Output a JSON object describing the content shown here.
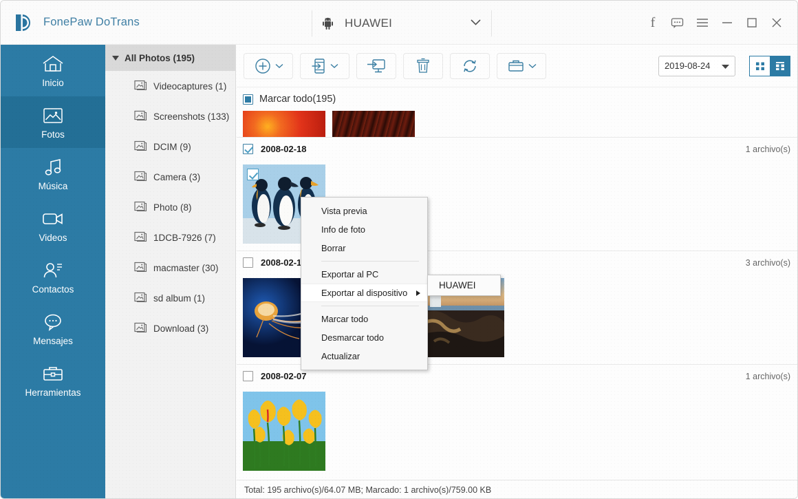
{
  "titlebar": {
    "app_name": "FonePaw DoTrans",
    "logo_glyph": "D",
    "device_name": "HUAWEI",
    "device_icon": "android-icon",
    "device_caret_icon": "chevron-down-icon",
    "controls": [
      {
        "name": "facebook-icon",
        "glyph": "f"
      },
      {
        "name": "feedback-icon",
        "glyph": "…"
      },
      {
        "name": "menu-icon",
        "glyph": "☰"
      },
      {
        "name": "minimize-icon",
        "glyph": "—"
      },
      {
        "name": "maximize-icon",
        "glyph": "□"
      },
      {
        "name": "close-icon",
        "glyph": "✕"
      }
    ]
  },
  "sidebar": {
    "items": [
      {
        "label": "Inicio",
        "icon": "home-icon",
        "active": false
      },
      {
        "label": "Fotos",
        "icon": "photo-icon",
        "active": true
      },
      {
        "label": "Música",
        "icon": "music-icon",
        "active": false
      },
      {
        "label": "Videos",
        "icon": "video-icon",
        "active": false
      },
      {
        "label": "Contactos",
        "icon": "contacts-icon",
        "active": false
      },
      {
        "label": "Mensajes",
        "icon": "message-icon",
        "active": false
      },
      {
        "label": "Herramientas",
        "icon": "toolbox-icon",
        "active": false
      }
    ]
  },
  "tree": {
    "header": "All Photos (195)",
    "header_caret_icon": "triangle-down-icon",
    "items": [
      {
        "label": "Videocaptures (1)",
        "icon": "album-icon"
      },
      {
        "label": "Screenshots (133)",
        "icon": "album-icon"
      },
      {
        "label": "DCIM (9)",
        "icon": "album-icon"
      },
      {
        "label": "Camera (3)",
        "icon": "album-icon"
      },
      {
        "label": "Photo (8)",
        "icon": "album-icon"
      },
      {
        "label": "1DCB-7926 (7)",
        "icon": "album-icon"
      },
      {
        "label": "macmaster (30)",
        "icon": "album-icon"
      },
      {
        "label": "sd album (1)",
        "icon": "album-icon"
      },
      {
        "label": "Download (3)",
        "icon": "album-icon"
      }
    ]
  },
  "toolbar": {
    "buttons": [
      {
        "name": "add-button",
        "icon": "plus-circle-icon",
        "has_caret": true
      },
      {
        "name": "export-to-device-button",
        "icon": "phone-export-icon",
        "has_caret": true
      },
      {
        "name": "export-to-pc-button",
        "icon": "monitor-export-icon",
        "has_caret": false
      },
      {
        "name": "delete-button",
        "icon": "trash-icon",
        "has_caret": false
      },
      {
        "name": "refresh-button",
        "icon": "refresh-icon",
        "has_caret": false
      },
      {
        "name": "album-button",
        "icon": "briefcase-icon",
        "has_caret": true
      }
    ],
    "date_filter_value": "2019-08-24",
    "date_filter_caret_icon": "caret-down-icon",
    "view_list_icon": "grid-small-icon",
    "view_grid_icon": "grid-large-icon",
    "accent_color": "#2c7ba5"
  },
  "content": {
    "select_all_label": "Marcar todo(195)",
    "groups": [
      {
        "date": "2008-02-18",
        "count_label": "1 archivo(s)",
        "checked": true,
        "photos": [
          {
            "name": "photo-penguins",
            "selected": true,
            "colors": [
              "#b7d6ec",
              "#17406b",
              "#f2f6fa"
            ]
          }
        ]
      },
      {
        "date": "2008-02-1",
        "count_label": "3 archivo(s)",
        "checked": false,
        "photos": [
          {
            "name": "photo-jellyfish",
            "selected": false,
            "colors": [
              "#0d2f6b",
              "#1452a8",
              "#e8a33c"
            ]
          },
          {
            "name": "photo-desert",
            "selected": false,
            "colors": [
              "#5c4030",
              "#c58a4e",
              "#e9cfa5"
            ]
          },
          {
            "name": "photo-lighthouse",
            "selected": false,
            "colors": [
              "#2a1f1a",
              "#8d6036",
              "#d9c2a0"
            ]
          }
        ]
      },
      {
        "date": "2008-02-07",
        "count_label": "1 archivo(s)",
        "checked": false,
        "photos": [
          {
            "name": "photo-tulips",
            "selected": false,
            "colors": [
              "#7fc4ea",
              "#f5c01e",
              "#2e7a20"
            ]
          }
        ]
      }
    ],
    "clipped_thumbs": [
      {
        "name": "photo-red-flower",
        "colors": [
          "#e2341a",
          "#f26a20"
        ]
      },
      {
        "name": "photo-dark-red",
        "colors": [
          "#3d110a",
          "#7a2110"
        ]
      }
    ]
  },
  "statusbar": {
    "text": "Total: 195 archivo(s)/64.07 MB; Marcado: 1 archivo(s)/759.00 KB"
  },
  "context_menu": {
    "items": [
      {
        "label": "Vista previa",
        "submenu": false,
        "separator_after": false
      },
      {
        "label": "Info de foto",
        "submenu": false,
        "separator_after": false
      },
      {
        "label": "Borrar",
        "submenu": false,
        "separator_after": true
      },
      {
        "label": "Exportar al PC",
        "submenu": false,
        "separator_after": false
      },
      {
        "label": "Exportar al dispositivo",
        "submenu": true,
        "separator_after": true
      },
      {
        "label": "Marcar todo",
        "submenu": false,
        "separator_after": false
      },
      {
        "label": "Desmarcar todo",
        "submenu": false,
        "separator_after": false
      },
      {
        "label": "Actualizar",
        "submenu": false,
        "separator_after": false
      }
    ],
    "submenu_item": "HUAWEI"
  }
}
